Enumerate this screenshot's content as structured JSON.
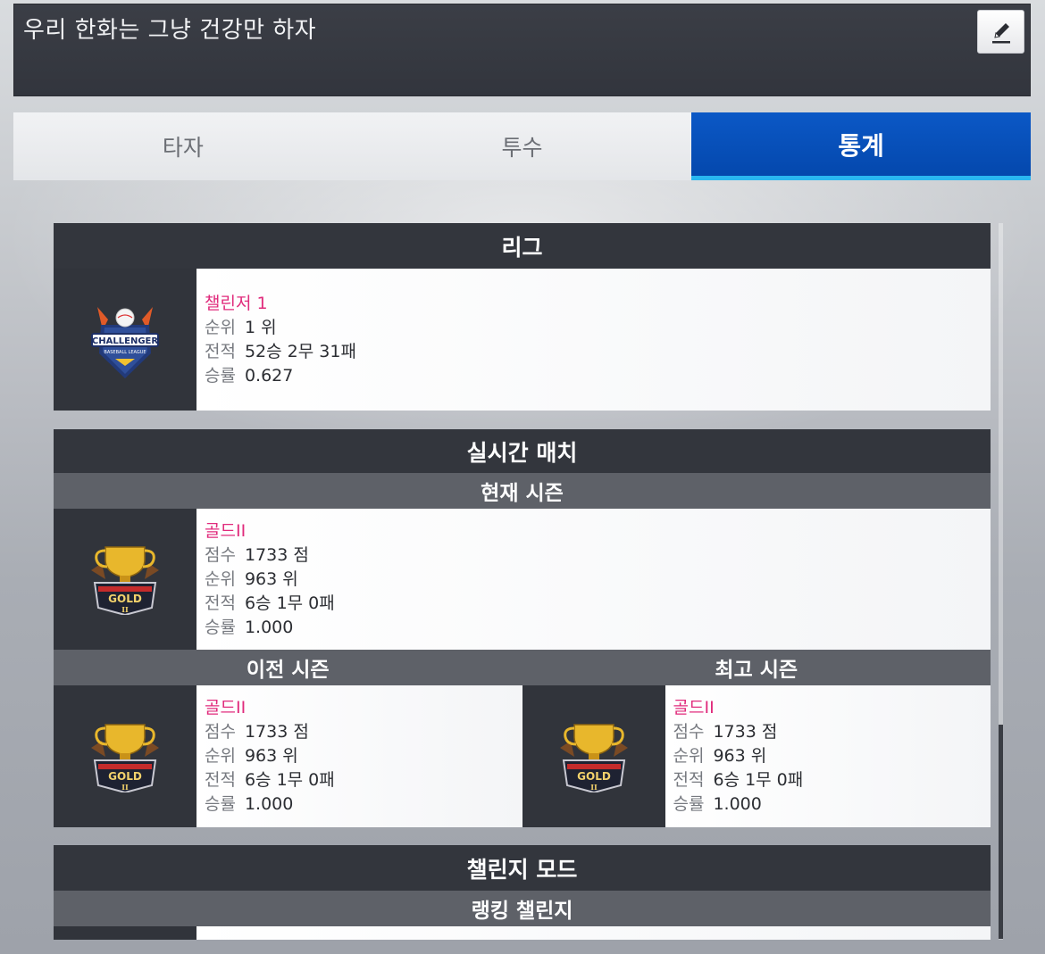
{
  "message": {
    "text": "우리 한화는 그냥 건강만 하자"
  },
  "edit_icon": "pencil-icon",
  "tabs": [
    {
      "label": "타자",
      "active": false
    },
    {
      "label": "투수",
      "active": false
    },
    {
      "label": "통계",
      "active": true
    }
  ],
  "colors": {
    "accent": "#0b58c6",
    "tab_underline": "#29b7f0",
    "tier_text": "#e02b7c",
    "header_bg": "#33363d"
  },
  "league": {
    "header": "리그",
    "emblem": "challenger-emblem-icon",
    "emblem_text": "CHALLENGER",
    "emblem_sub": "BASEBALL LEAGUE",
    "tier": "챌린저 1",
    "rank_label": "순위",
    "rank_value": "1 위",
    "record_label": "전적",
    "record_value": "52승 2무 31패",
    "winrate_label": "승률",
    "winrate_value": "0.627"
  },
  "realtime": {
    "header": "실시간 매치",
    "current": {
      "header": "현재 시즌",
      "emblem": "gold-trophy-icon",
      "emblem_text": "GOLD",
      "emblem_roman": "II",
      "tier": "골드II",
      "score_label": "점수",
      "score_value": "1733 점",
      "rank_label": "순위",
      "rank_value": "963 위",
      "record_label": "전적",
      "record_value": "6승 1무 0패",
      "winrate_label": "승률",
      "winrate_value": "1.000"
    },
    "previous": {
      "header": "이전 시즌",
      "emblem": "gold-trophy-icon",
      "tier": "골드II",
      "score_label": "점수",
      "score_value": "1733 점",
      "rank_label": "순위",
      "rank_value": "963 위",
      "record_label": "전적",
      "record_value": "6승 1무 0패",
      "winrate_label": "승률",
      "winrate_value": "1.000"
    },
    "best": {
      "header": "최고 시즌",
      "emblem": "gold-trophy-icon",
      "tier": "골드II",
      "score_label": "점수",
      "score_value": "1733 점",
      "rank_label": "순위",
      "rank_value": "963 위",
      "record_label": "전적",
      "record_value": "6승 1무 0패",
      "winrate_label": "승률",
      "winrate_value": "1.000"
    }
  },
  "challenge_mode": {
    "header": "챌린지 모드",
    "sub_header": "랭킹 챌린지"
  }
}
